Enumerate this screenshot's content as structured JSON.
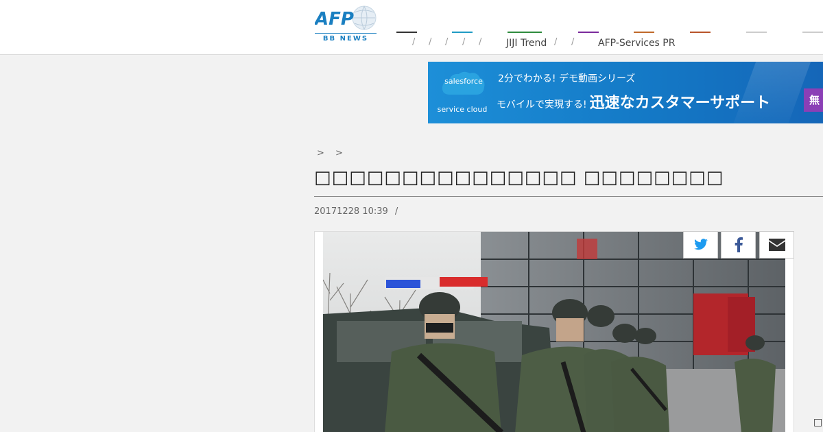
{
  "header": {
    "logo": {
      "text": "AFP",
      "sub": "BB NEWS"
    },
    "nav_lines": [
      {
        "color": "#333333"
      },
      {
        "color": "#1f9bc4"
      },
      {
        "color": "#2e8b3d"
      },
      {
        "color": "#7a2a9c"
      },
      {
        "color": "#c0692a"
      },
      {
        "color": "#b8542a"
      },
      {
        "color": "#cccccc"
      },
      {
        "color": "#cccccc"
      }
    ],
    "nav_separators": [
      "/",
      "/",
      "/",
      "/",
      "/",
      "/",
      "/"
    ],
    "nav_items": {
      "jiji": "JIJI Trend",
      "afp_services": "AFP-Services PR"
    }
  },
  "banner": {
    "brand": "salesforce",
    "service": "service cloud",
    "line1": "2分でわかる! デモ動画シリーズ",
    "line2_prefix": "モバイルで実現する!",
    "line2_main": "迅速なカスタマーサポート",
    "tag": "無"
  },
  "article": {
    "breadcrumb": "> >",
    "title": "□□□□□□□□□□□□□□□ □□□□□□□□",
    "date": "20171228 10:39",
    "meta_sep": "/"
  },
  "share": {
    "twitter": "twitter-icon",
    "facebook": "facebook-icon",
    "mail": "mail-icon"
  },
  "corner_glyph": "□"
}
